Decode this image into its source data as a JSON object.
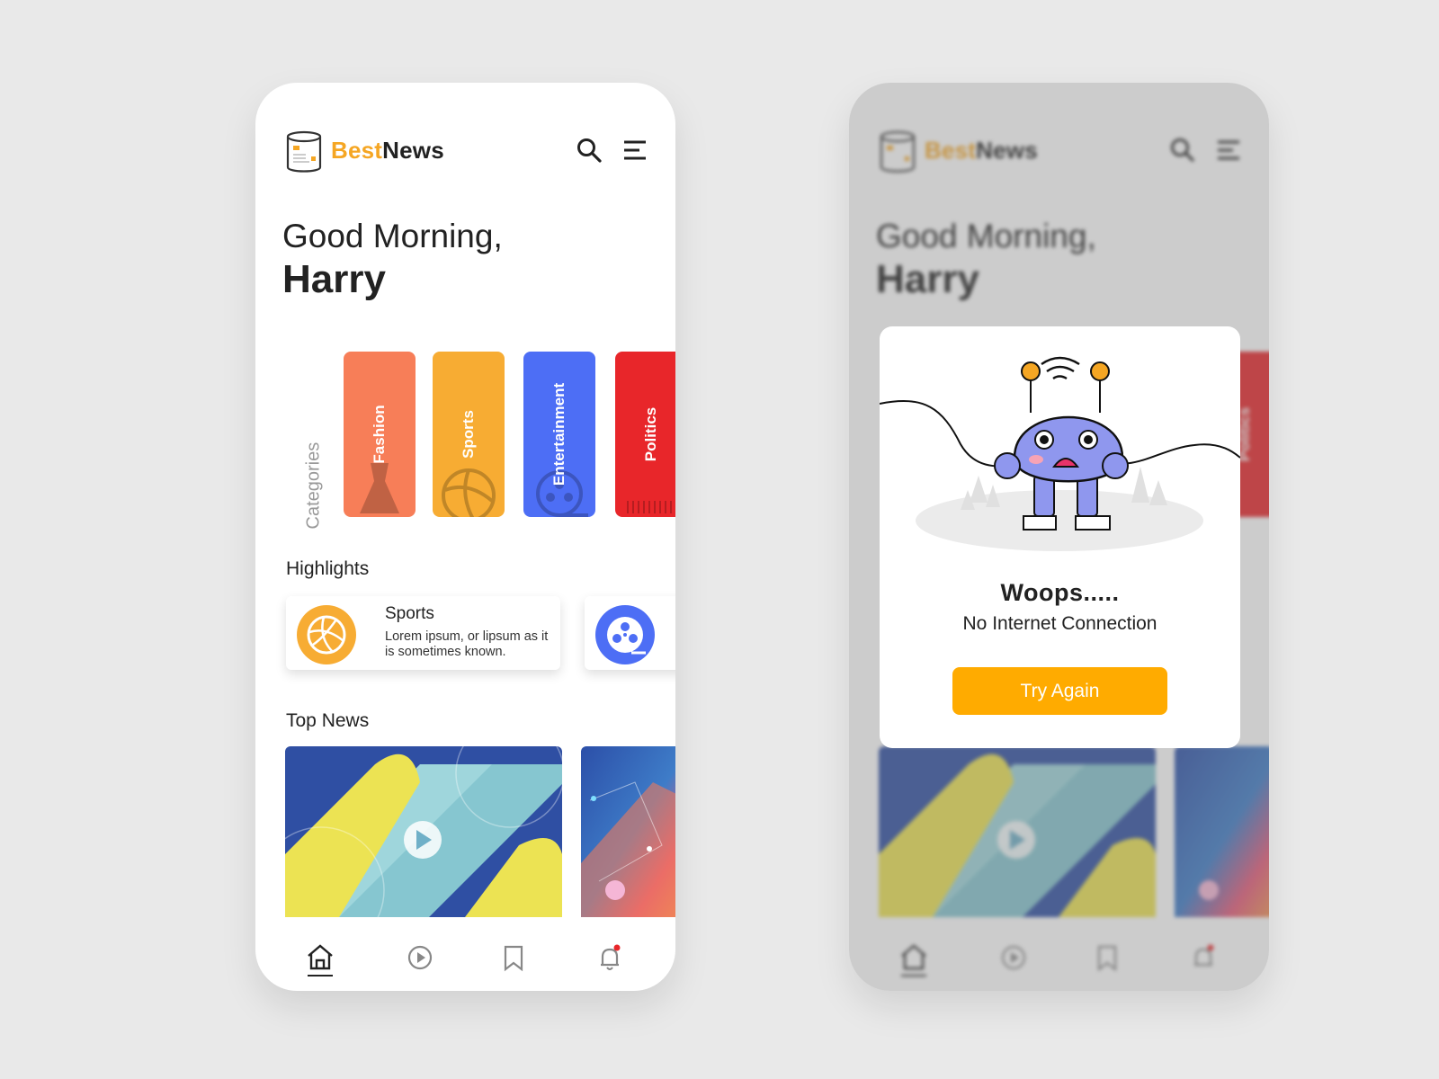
{
  "app": {
    "brand_part1": "Best",
    "brand_part2": "News",
    "icons": [
      "newspaper-logo-icon",
      "search-icon",
      "menu-icon"
    ]
  },
  "greeting": {
    "line1": "Good Morning,",
    "name": "Harry"
  },
  "categories": {
    "label": "Categories",
    "items": [
      {
        "label": "Fashion",
        "color": "#f77e58",
        "icon": "dress-icon"
      },
      {
        "label": "Sports",
        "color": "#f7ac33",
        "icon": "basketball-icon"
      },
      {
        "label": "Entertainment",
        "color": "#4d6ef5",
        "icon": "film-reel-icon"
      },
      {
        "label": "Politics",
        "color": "#e8262a",
        "icon": "podium-icon"
      }
    ]
  },
  "highlights": {
    "title": "Highlights",
    "items": [
      {
        "title": "Sports",
        "desc": "Lorem ipsum, or lipsum as it is sometimes known.",
        "icon": "basketball-icon",
        "color": "#f7ac33"
      },
      {
        "title": "",
        "desc": "",
        "icon": "film-reel-icon",
        "color": "#4d6ef5"
      }
    ]
  },
  "top_news": {
    "title": "Top News",
    "items": [
      {
        "icon": "play-icon"
      },
      {
        "icon": "abstract-image"
      }
    ]
  },
  "bottom_nav": {
    "items": [
      "home-icon",
      "video-play-icon",
      "bookmark-icon",
      "bell-icon"
    ],
    "active": "home-icon"
  },
  "error_modal": {
    "title": "Woops.....",
    "message": "No Internet Connection",
    "button_label": "Try Again",
    "button_color": "#ffab00",
    "illustration": "sad-robot-illustration"
  }
}
